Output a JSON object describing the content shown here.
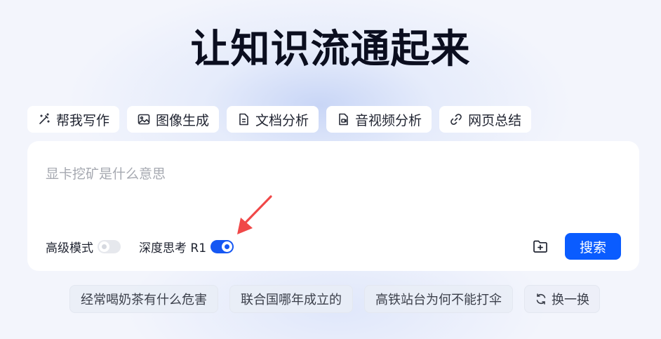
{
  "headline": "让知识流通起来",
  "tools": [
    {
      "label": "帮我写作",
      "icon": "magic-wand-icon"
    },
    {
      "label": "图像生成",
      "icon": "image-icon"
    },
    {
      "label": "文档分析",
      "icon": "document-icon"
    },
    {
      "label": "音视频分析",
      "icon": "media-file-icon"
    },
    {
      "label": "网页总结",
      "icon": "link-icon"
    }
  ],
  "search": {
    "placeholder": "显卡挖矿是什么意思",
    "value": ""
  },
  "modes": {
    "advanced": {
      "label": "高级模式",
      "enabled": false
    },
    "deep_think": {
      "label": "深度思考 R1",
      "enabled": true
    }
  },
  "buttons": {
    "upload_icon": "folder-plus-icon",
    "search_label": "搜索"
  },
  "suggestions": [
    "经常喝奶茶有什么危害",
    "联合国哪年成立的",
    "高铁站台为何不能打伞"
  ],
  "refresh_label": "换一换",
  "colors": {
    "accent": "#0a5cff",
    "toggle_on": "#1557f3",
    "annotation_arrow": "#f04848"
  }
}
